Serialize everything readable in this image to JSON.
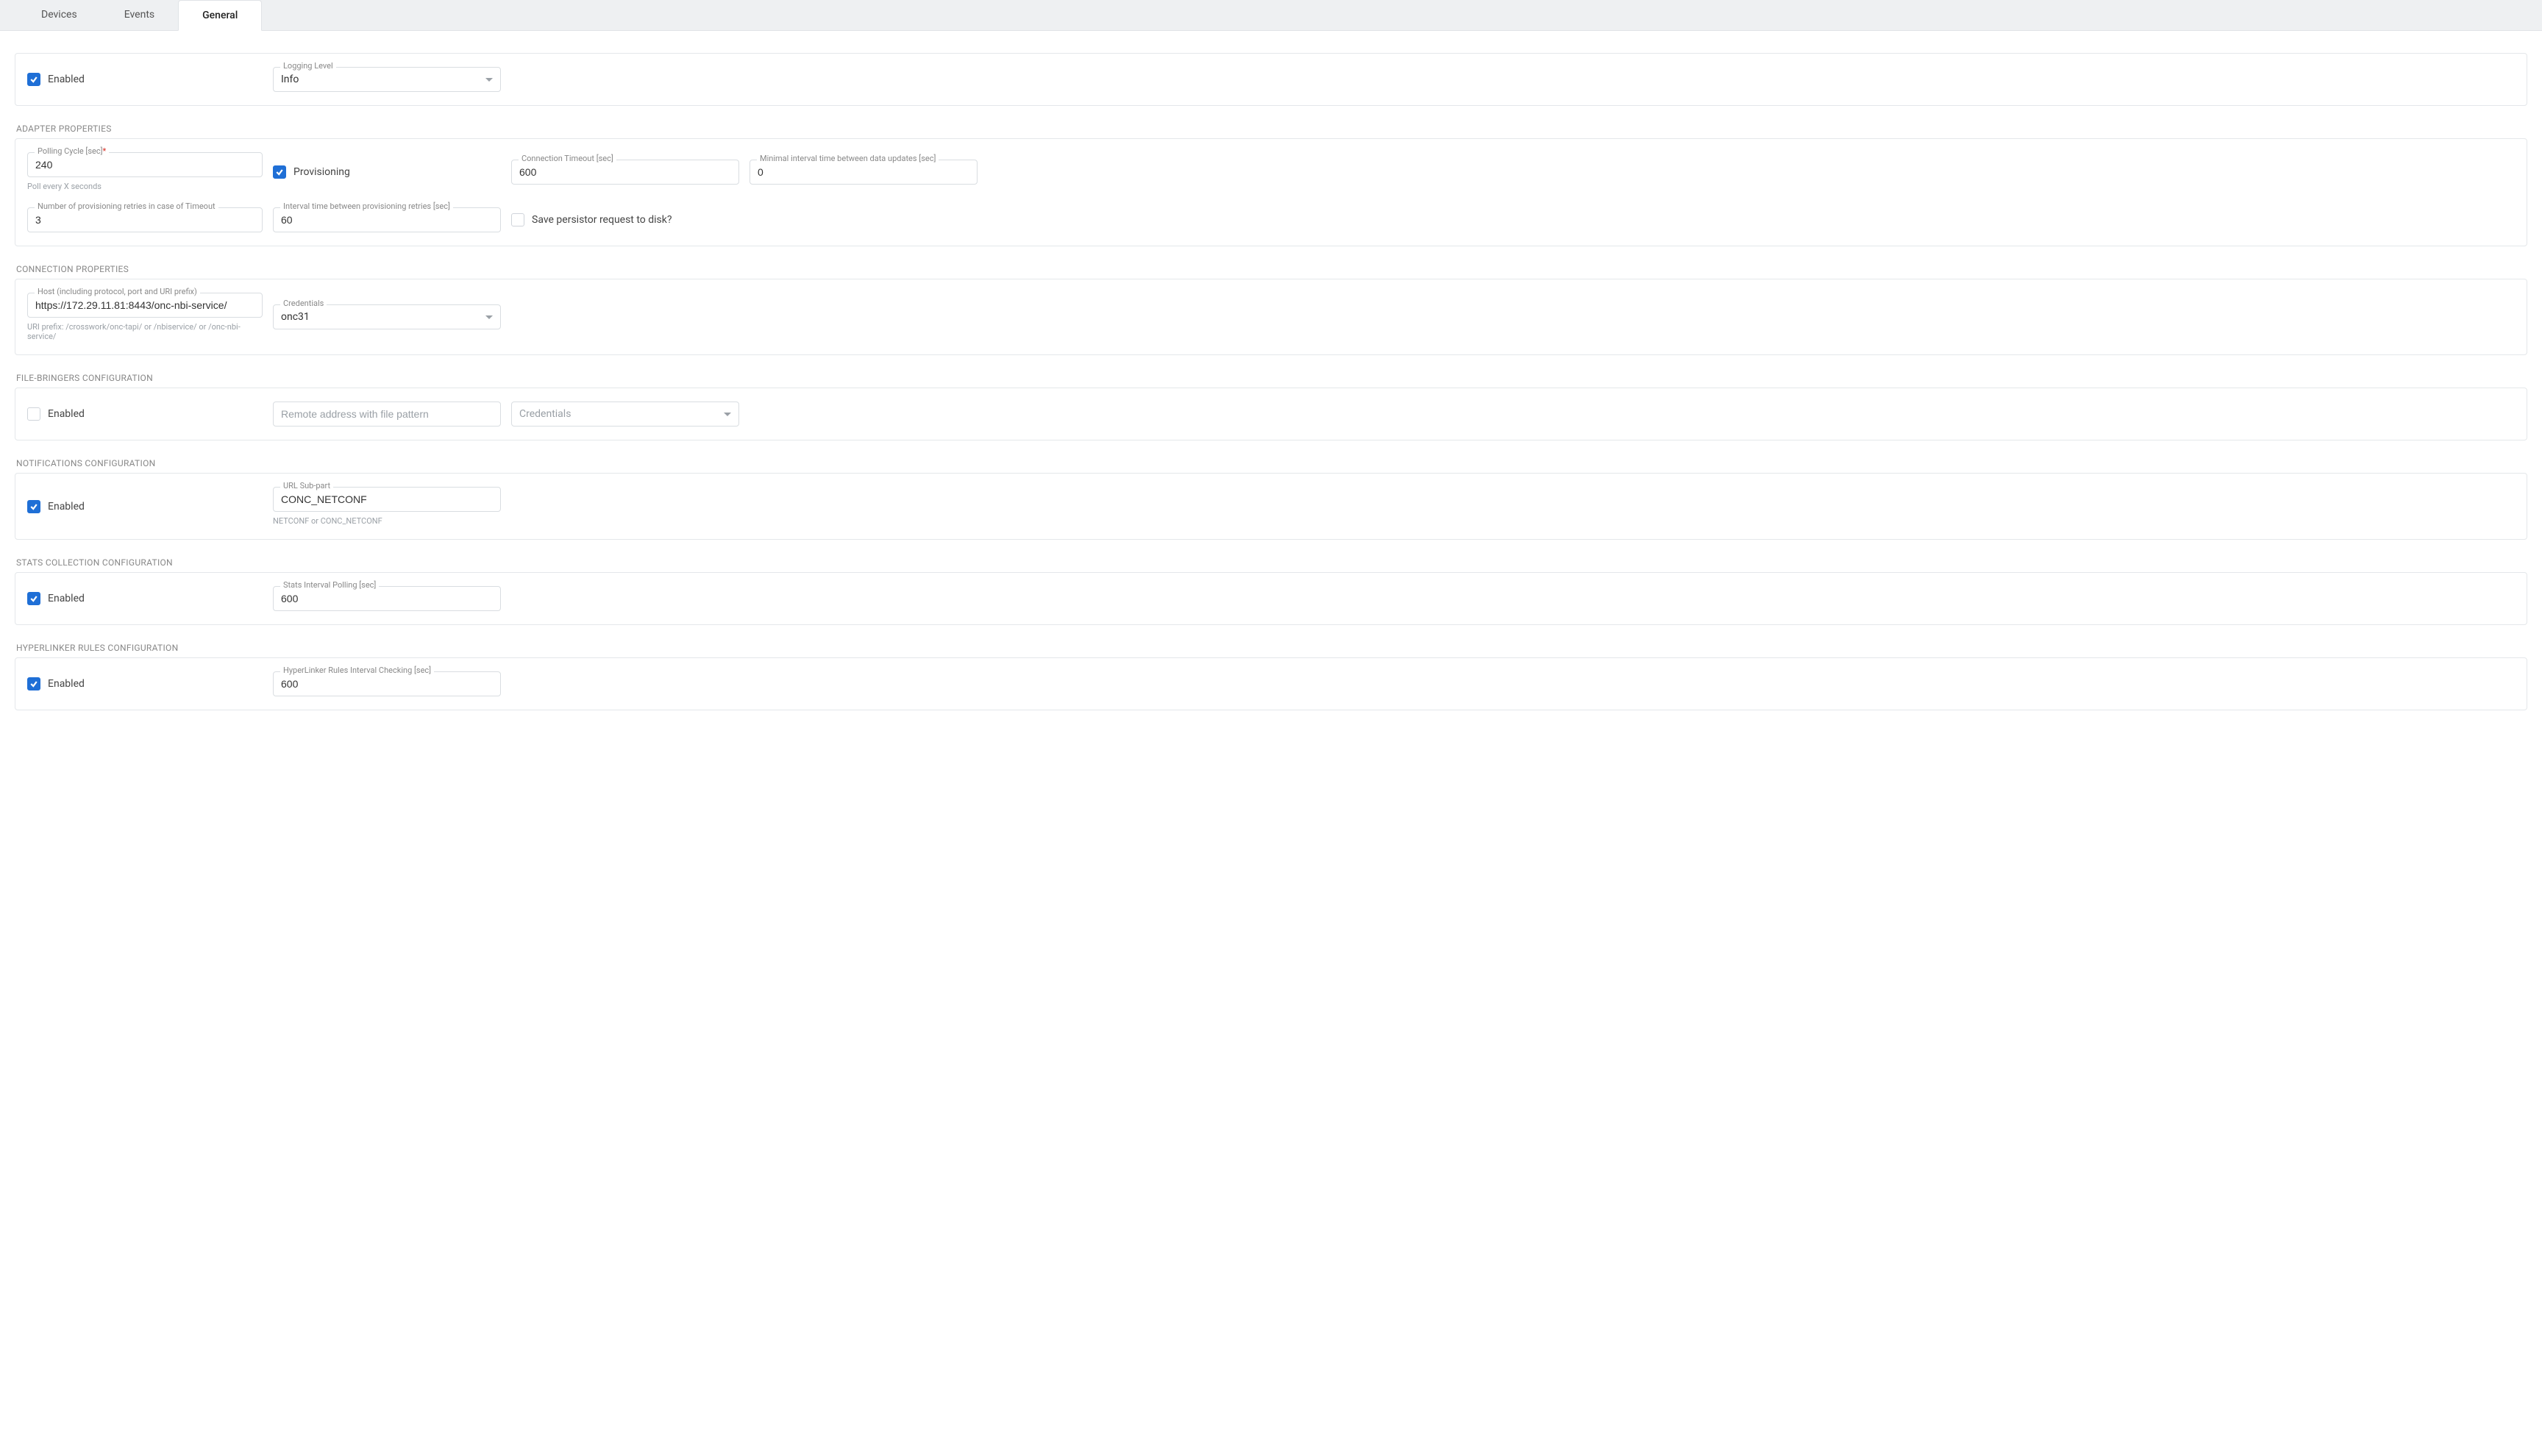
{
  "tabs": {
    "devices": "Devices",
    "events": "Events",
    "general": "General"
  },
  "top": {
    "enabled_label": "Enabled",
    "logging_level_label": "Logging Level",
    "logging_level_value": "Info"
  },
  "adapter": {
    "title": "ADAPTER PROPERTIES",
    "polling_cycle_label": "Polling Cycle [sec]",
    "polling_cycle_value": "240",
    "polling_helper": "Poll every X seconds",
    "provisioning_label": "Provisioning",
    "connection_timeout_label": "Connection Timeout [sec]",
    "connection_timeout_value": "600",
    "min_interval_label": "Minimal interval time between data updates [sec]",
    "min_interval_value": "0",
    "retries_label": "Number of provisioning retries in case of Timeout",
    "retries_value": "3",
    "interval_retries_label": "Interval time between provisioning retries [sec]",
    "interval_retries_value": "60",
    "save_persistor_label": "Save persistor request to disk?"
  },
  "connection": {
    "title": "CONNECTION PROPERTIES",
    "host_label": "Host (including protocol, port and URI prefix)",
    "host_value": "https://172.29.11.81:8443/onc-nbi-service/",
    "host_helper": "URI prefix: /crosswork/onc-tapi/ or /nbiservice/ or /onc-nbi-service/",
    "credentials_label": "Credentials",
    "credentials_value": "onc31"
  },
  "filebringers": {
    "title": "FILE-BRINGERS CONFIGURATION",
    "enabled_label": "Enabled",
    "remote_placeholder": "Remote address with file pattern",
    "credentials_placeholder": "Credentials"
  },
  "notifications": {
    "title": "NOTIFICATIONS CONFIGURATION",
    "enabled_label": "Enabled",
    "url_subpart_label": "URL Sub-part",
    "url_subpart_value": "CONC_NETCONF",
    "url_subpart_helper": "NETCONF or CONC_NETCONF"
  },
  "stats": {
    "title": "STATS COLLECTION CONFIGURATION",
    "enabled_label": "Enabled",
    "interval_label": "Stats Interval Polling [sec]",
    "interval_value": "600"
  },
  "hyperlinker": {
    "title": "HYPERLINKER RULES CONFIGURATION",
    "enabled_label": "Enabled",
    "interval_label": "HyperLinker Rules Interval Checking [sec]",
    "interval_value": "600"
  }
}
